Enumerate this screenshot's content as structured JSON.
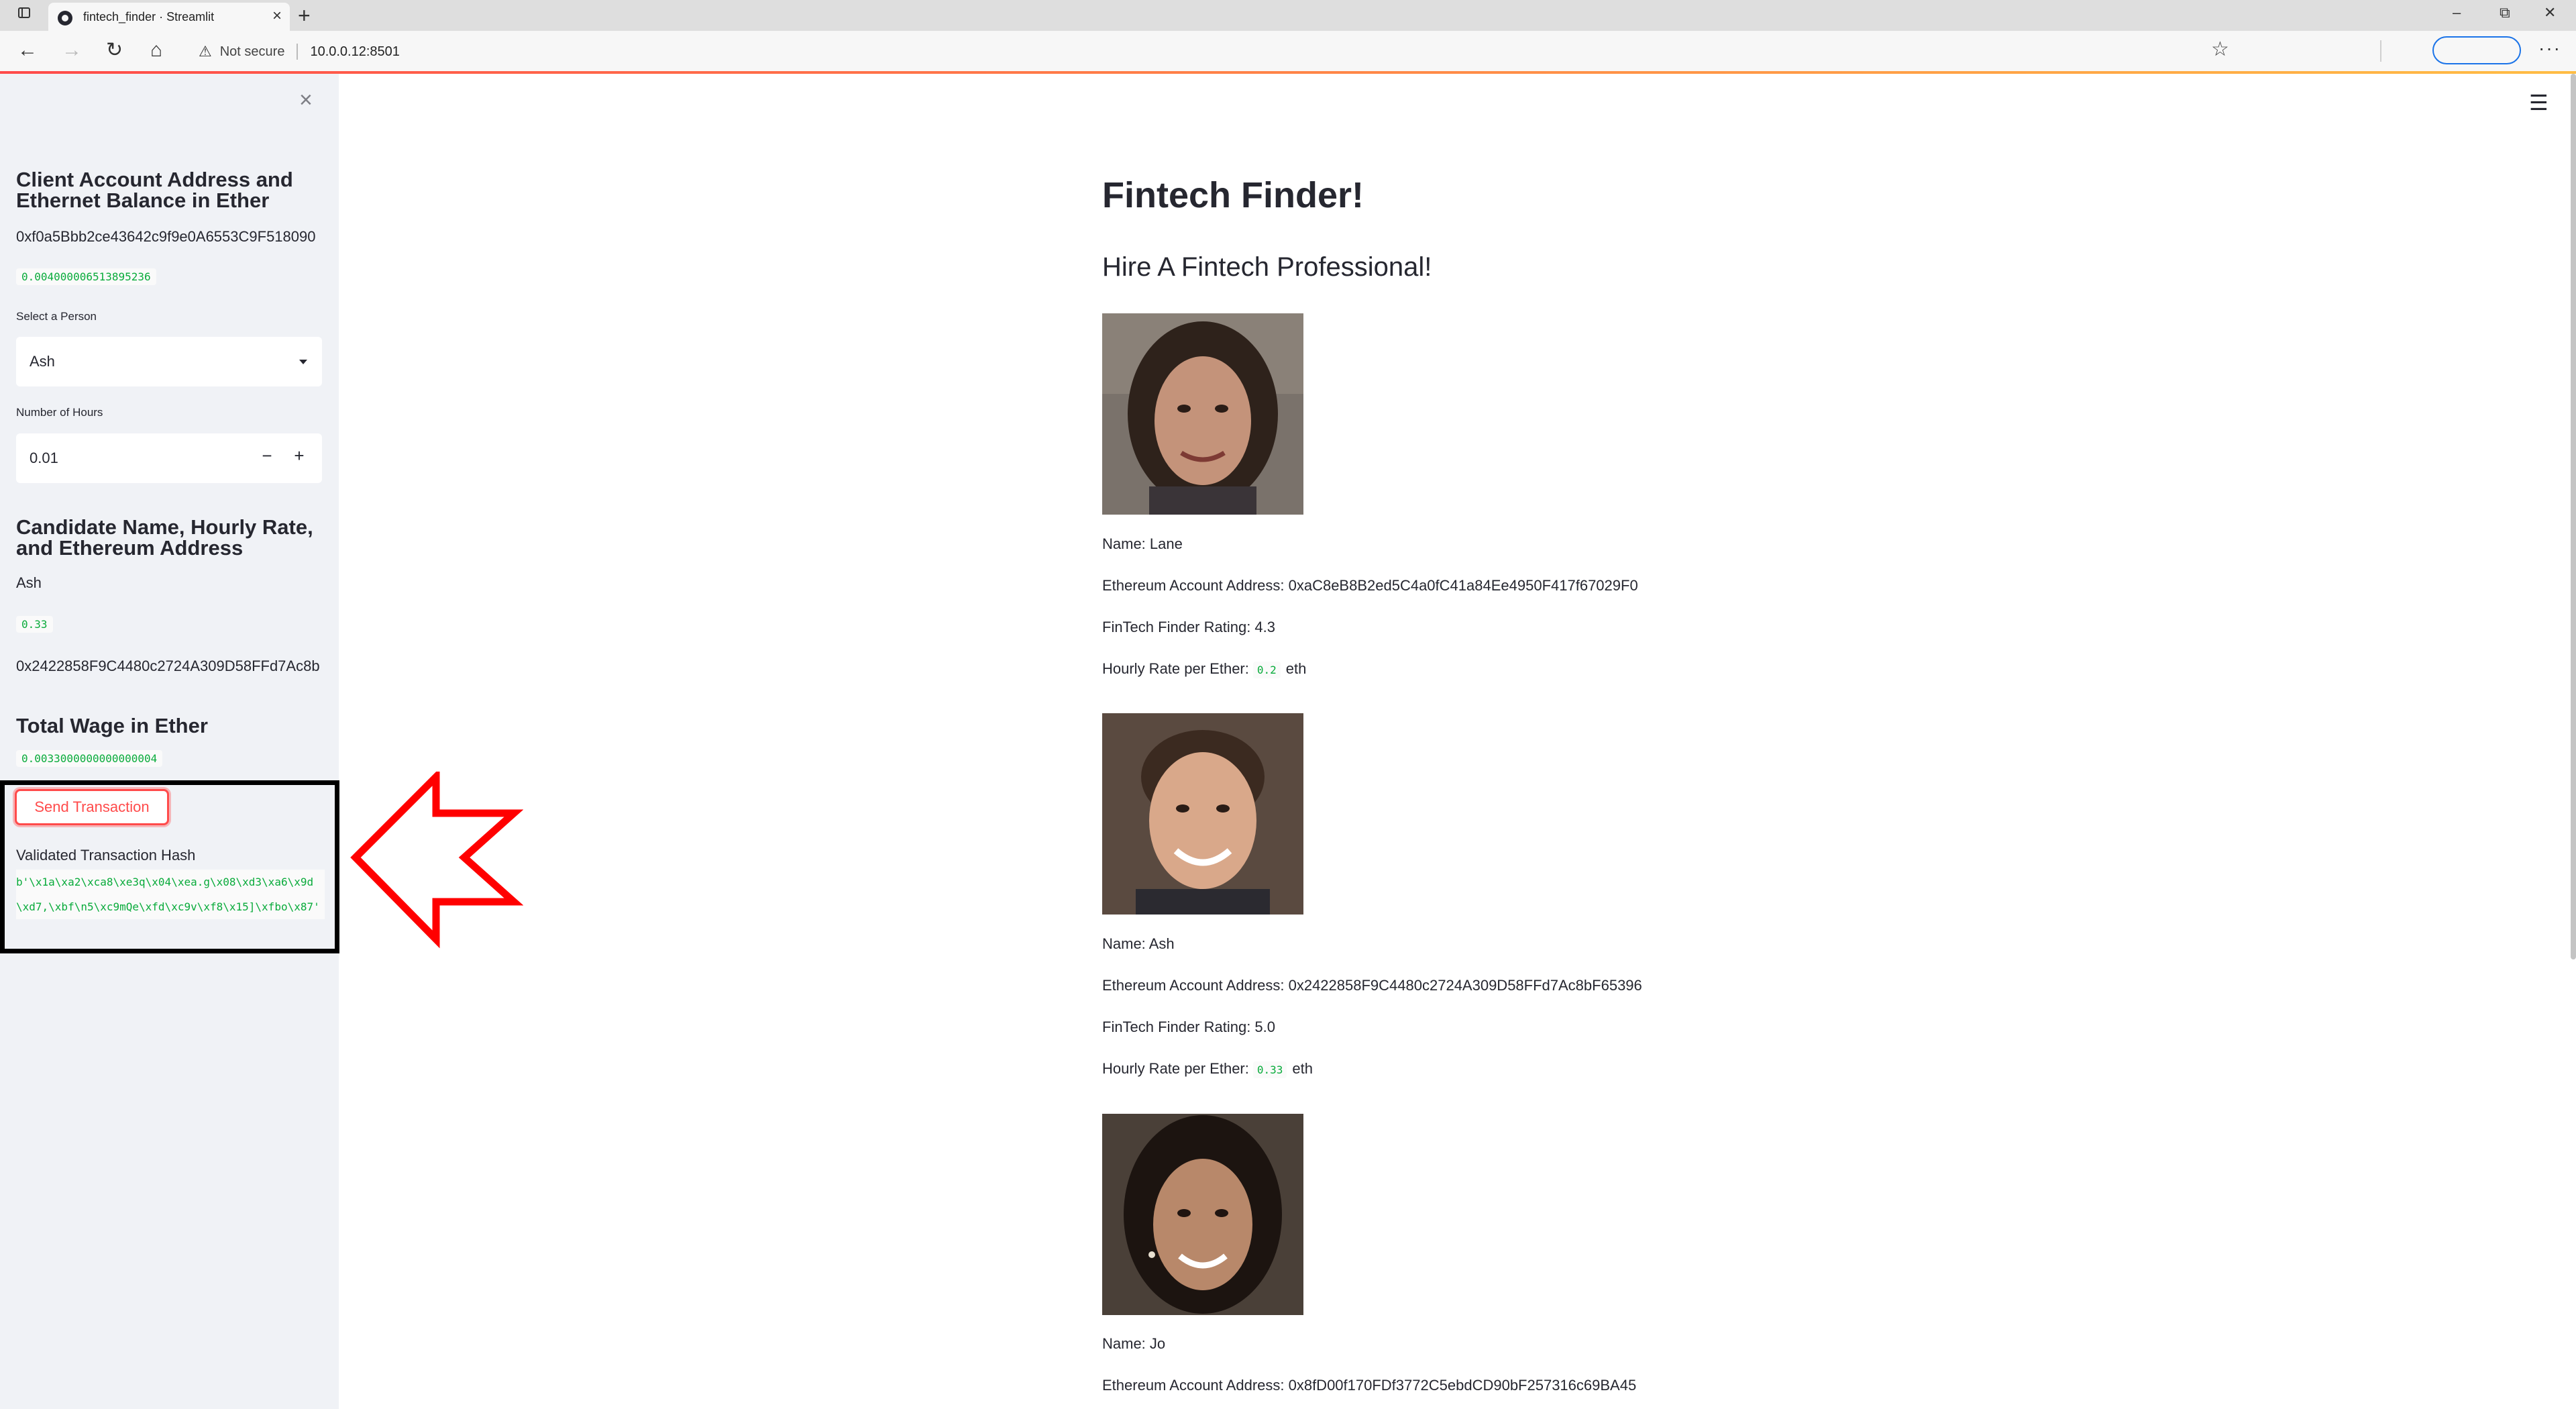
{
  "browser": {
    "tab_title": "fintech_finder · Streamlit",
    "tab_close": "×",
    "new_tab": "+",
    "security_label": "Not secure",
    "url": "10.0.0.12:8501",
    "icons": [
      "tab-actions-icon",
      "favicon-icon",
      "back-icon",
      "forward-icon",
      "reload-icon",
      "home-icon",
      "warning-icon",
      "favorites-icon",
      "more-icon",
      "minimize-icon",
      "restore-icon",
      "close-window-icon"
    ]
  },
  "sidebar": {
    "close_icon": "×",
    "account_heading": "Client Account Address and Ethernet Balance in Ether",
    "account_address": "0xf0a5Bbb2ce43642c9f9e0A6553C9F518090",
    "balance": "0.004000006513895236",
    "select_label": "Select a Person",
    "selected_person": "Ash",
    "hours_label": "Number of Hours",
    "hours_value": "0.01",
    "minus": "−",
    "plus": "+",
    "candidate_heading": "Candidate Name, Hourly Rate, and Ethereum Address",
    "candidate_name": "Ash",
    "candidate_rate": "0.33",
    "candidate_address": "0x2422858F9C4480c2724A309D58FFd7Ac8b",
    "wage_heading": "Total Wage in Ether",
    "total_wage": "0.0033000000000000004",
    "send_button": "Send Transaction",
    "hash_label": "Validated Transaction Hash",
    "hash_value": "b'\\x1a\\xa2\\xca8\\xe3q\\x04\\xea.g\\x08\\xd3\\xa6\\x9d\\xd7,\\xbf\\n5\\xc9mQe\\xfd\\xc9v\\xf8\\x15]\\xfbo\\x87'"
  },
  "annotation": {
    "highlight_color": "#000000",
    "arrow_color": "#ff0000"
  },
  "main": {
    "menu_icon": "☰",
    "title": "Fintech Finder!",
    "subtitle": "Hire A Fintech Professional!",
    "candidates": [
      {
        "name": "Name: Lane",
        "address": "Ethereum Account Address: 0xaC8eB8B2ed5C4a0fC41a84Ee4950F417f67029F0",
        "rating": "FinTech Finder Rating: 4.3",
        "rate_prefix": "Hourly Rate per Ether:",
        "rate": "0.2",
        "rate_unit": "eth"
      },
      {
        "name": "Name: Ash",
        "address": "Ethereum Account Address: 0x2422858F9C4480c2724A309D58FFd7Ac8bF65396",
        "rating": "FinTech Finder Rating: 5.0",
        "rate_prefix": "Hourly Rate per Ether:",
        "rate": "0.33",
        "rate_unit": "eth"
      },
      {
        "name": "Name: Jo",
        "address": "Ethereum Account Address: 0x8fD00f170FDf3772C5ebdCD90bF257316c69BA45"
      }
    ]
  },
  "colors": {
    "accent": "#ff4b4b",
    "code_green": "#09ab3b",
    "sidebar_bg": "#f0f2f6",
    "text": "#262730"
  }
}
